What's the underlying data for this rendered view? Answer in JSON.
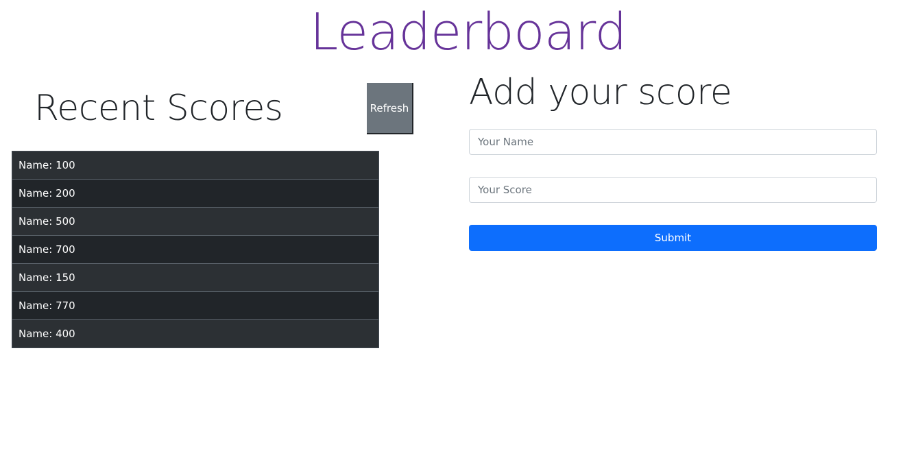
{
  "colors": {
    "title": "#663399",
    "refresh_bg": "#6c757d",
    "table_odd": "#2c3034",
    "table_even": "#212529",
    "submit_bg": "#0d6efd"
  },
  "header": {
    "title": "Leaderboard"
  },
  "recent": {
    "heading": "Recent Scores",
    "refresh_label": "Refresh",
    "scores": [
      "Name: 100",
      "Name: 200",
      "Name: 500",
      "Name: 700",
      "Name: 150",
      "Name: 770",
      "Name: 400"
    ]
  },
  "form": {
    "heading": "Add your score",
    "name_placeholder": "Your Name",
    "name_value": "",
    "score_placeholder": "Your Score",
    "score_value": "",
    "submit_label": "Submit"
  }
}
